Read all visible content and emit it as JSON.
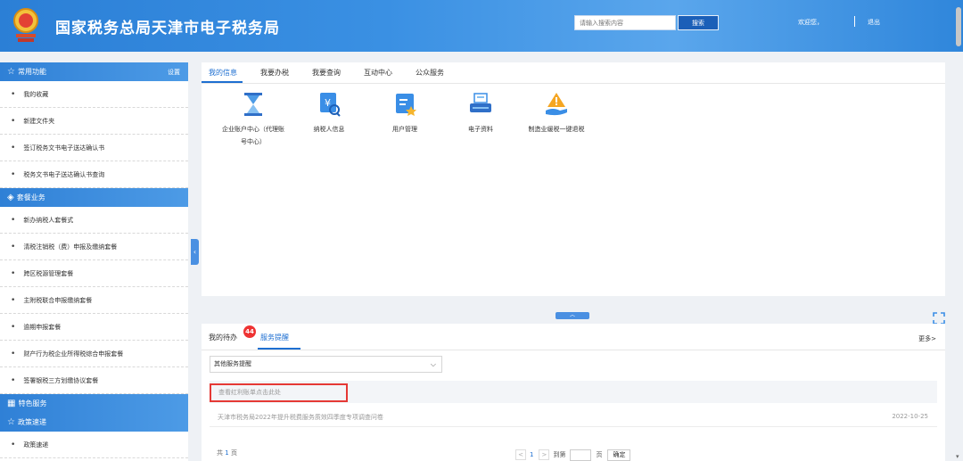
{
  "header": {
    "title": "国家税务总局天津市电子税务局",
    "search_placeholder": "请输入搜索内容",
    "search_button": "搜索",
    "welcome": "欢迎您，",
    "logout": "退出"
  },
  "sidebar": {
    "common": {
      "title": "常用功能",
      "settings": "设置",
      "items": [
        "我的收藏",
        "新建文件夹",
        "签订税务文书电子送达确认书",
        "税务文书电子送达确认书查询"
      ]
    },
    "packages": {
      "title": "套餐业务",
      "items": [
        "新办纳税人套餐式",
        "清税注销税（费）申报及缴纳套餐",
        "跨区税源管理套餐",
        "主附税联合申报缴纳套餐",
        "逾期申报套餐",
        "财产行为税企业所得税综合申报套餐",
        "签署银税三方划缴协议套餐"
      ]
    },
    "special": {
      "title": "特色服务"
    },
    "policy": {
      "title": "政策速递",
      "items": [
        "政策速递"
      ]
    }
  },
  "main": {
    "tabs": [
      "我的信息",
      "我要办税",
      "我要查询",
      "互动中心",
      "公众服务"
    ],
    "services": [
      {
        "label_line1": "企业账户中心（代理账",
        "label_line2": "号中心）",
        "icon": "hourglass-icon"
      },
      {
        "label_line1": "纳税人信息",
        "icon": "taxpayer-search-icon"
      },
      {
        "label_line1": "用户管理",
        "icon": "user-card-icon"
      },
      {
        "label_line1": "电子资料",
        "icon": "scanner-icon"
      },
      {
        "label_line1": "制造业缓税一键退税",
        "icon": "warning-hand-icon"
      }
    ]
  },
  "bottom": {
    "tab_todo": "我的待办",
    "badge_count": "44",
    "tab_reminder": "服务提醒",
    "more": "更多>",
    "select_value": "其他服务提醒",
    "notice": "查看红利账单点击此处",
    "news": [
      {
        "title": "天津市税务局2022年提升税费服务质效四季度专项调查问卷",
        "date": "2022-10-25"
      }
    ],
    "total_prefix": "共",
    "total_pages": "1",
    "total_suffix": "页",
    "pager": {
      "prev": "<",
      "current": "1",
      "next": ">",
      "goto": "到第",
      "page_unit": "页",
      "confirm": "确定"
    }
  },
  "colors": {
    "primary": "#1e6fd1",
    "header": "#2b7fd6",
    "badge": "#e33333",
    "highlight_border": "#e53935"
  }
}
